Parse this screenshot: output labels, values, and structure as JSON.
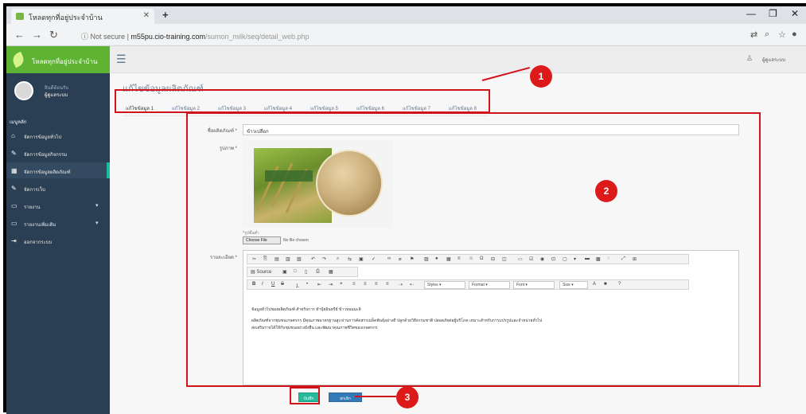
{
  "browser": {
    "tab_title": "โหลดทุกที่อยู่ประจำบ้าน",
    "new_tab": "+",
    "url_security": "Not secure",
    "url_host": "m55pu.cio-training.com",
    "url_path": "/sumon_milk/seq/detail_web.php"
  },
  "sidebar": {
    "brand": "โหลดทุกที่อยู่ประจำบ้าน",
    "profile_welcome": "ยินดีต้อนรับ",
    "profile_name": "ผู้ดูแลระบบ",
    "menu_head": "เมนูหลัก",
    "items": [
      {
        "label": "จัดการข้อมูลทั่วไป",
        "icon": "home-icon"
      },
      {
        "label": "จัดการข้อมูลกิจกรรม",
        "icon": "edit-icon"
      },
      {
        "label": "จัดการข้อมูลผลิตภัณฑ์",
        "icon": "table-icon"
      },
      {
        "label": "จัดการเว็บ",
        "icon": "edit-icon"
      },
      {
        "label": "รายงาน",
        "icon": "desktop-icon"
      },
      {
        "label": "รายงานเพิ่มเติม",
        "icon": "desktop-icon"
      },
      {
        "label": "ออกจากระบบ",
        "icon": "logout-icon"
      }
    ]
  },
  "topbar": {
    "user": "ผู้ดูแลระบบ"
  },
  "page": {
    "title": "แก้ไขข้อมูลผลิตภัณฑ์",
    "tabs": [
      "แก้ไขข้อมูล 1",
      "แก้ไขข้อมูล 2",
      "แก้ไขข้อมูล 3",
      "แก้ไขข้อมูล 4",
      "แก้ไขข้อมูล 5",
      "แก้ไขข้อมูล 6",
      "แก้ไขข้อมูล 7",
      "แก้ไขข้อมูล 8"
    ]
  },
  "form": {
    "name_label": "ชื่อผลิตภัณฑ์ *",
    "name_value": "ข้าวเปลือก",
    "image_label": "รูปภาพ *",
    "image_hint": "*รูปขั้นต่ำ",
    "choose_file": "Choose File",
    "no_file": "No file chosen",
    "detail_label": "รายละเอียด *",
    "editor_line1": "ข้อมูลทั่วไปของผลิตภัณฑ์ สำหรับการ ทำปุ๋ยอินทรีย์ ข้าวหอมมะลิ",
    "editor_line2": "ผลิตภัณฑ์จากชุมชนเกษตรกร มีคุณภาพมาตรฐานสูง ผ่านการคัดสรรเมล็ดพันธุ์อย่างดี ปลูกด้วยวิธีธรรมชาติ ปลอดภัยต่อผู้บริโภค เหมาะสำหรับการแปรรูปและจำหน่ายทั่วไป",
    "editor_line3": "ส่งเสริมรายได้ให้กับชุมชนอย่างยั่งยืน และพัฒนาคุณภาพชีวิตของเกษตรกร"
  },
  "editor_toolbar": {
    "source": "Source",
    "styles": "Styles",
    "format": "Format",
    "font": "Font",
    "size": "Size",
    "bold": "B",
    "italic": "I",
    "underline": "U",
    "strike": "S",
    "help": "?"
  },
  "actions": {
    "save": "บันทึก",
    "cancel": "ยกเลิก"
  },
  "annotations": [
    "1",
    "2",
    "3"
  ],
  "colors": {
    "sidebar": "#2a3f54",
    "brand": "#5fb333",
    "save": "#26b99a",
    "cancel": "#337ab7",
    "annotation": "#d0141c"
  }
}
